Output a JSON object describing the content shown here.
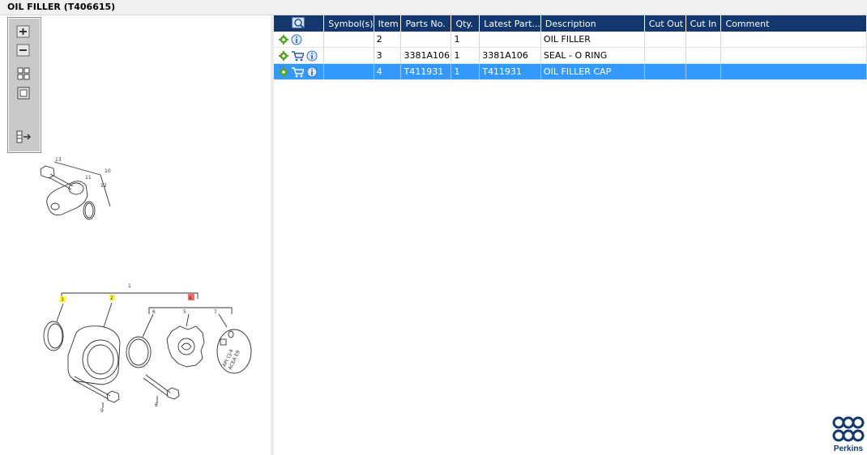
{
  "window": {
    "title": "OIL FILLER (T406615)"
  },
  "toolbar": {
    "buttons": [
      {
        "name": "zoom-in-button",
        "icon": "zoom-in-icon"
      },
      {
        "name": "zoom-out-button",
        "icon": "zoom-out-icon"
      },
      {
        "name": "fit-all-button",
        "icon": "fit-all-icon"
      },
      {
        "name": "fit-window-button",
        "icon": "fit-window-icon"
      },
      {
        "name": "layout-toggle-button",
        "icon": "layout-toggle-icon"
      }
    ]
  },
  "diagram": {
    "callouts": [
      "13",
      "10",
      "11",
      "12",
      "1",
      "3",
      "2",
      "4",
      "6",
      "5",
      "7",
      "9",
      "8"
    ],
    "label_text": [
      "API CJ-4",
      "ACEA E9"
    ],
    "highlight_colors": {
      "yellow": "#ffff33",
      "red": "#ff6666"
    }
  },
  "grid": {
    "header_icon": "search-icon",
    "columns": [
      "Symbol(s)",
      "Item",
      "Parts No.",
      "Qty.",
      "Latest Part...",
      "Description",
      "Cut Out",
      "Cut In",
      "Comment"
    ],
    "rows": [
      {
        "icons": [
          "gear-icon",
          "info-icon"
        ],
        "symbol": "",
        "item": "2",
        "parts_no": "",
        "qty": "1",
        "latest": "",
        "description": "OIL FILLER",
        "cut_out": "",
        "cut_in": "",
        "comment": ""
      },
      {
        "icons": [
          "gear-icon",
          "cart-icon",
          "info-icon"
        ],
        "symbol": "",
        "item": "3",
        "parts_no": "3381A106",
        "qty": "1",
        "latest": "3381A106",
        "description": "SEAL - O RING",
        "cut_out": "",
        "cut_in": "",
        "comment": ""
      },
      {
        "icons": [
          "gear-icon",
          "cart-icon",
          "info-icon"
        ],
        "symbol": "",
        "item": "4",
        "parts_no": "T411931",
        "qty": "1",
        "latest": "T411931",
        "description": "OIL FILLER CAP",
        "cut_out": "",
        "cut_in": "",
        "comment": "",
        "selected": true
      }
    ]
  },
  "colors": {
    "header_bg": "#14386e",
    "selected_row": "#3399ff",
    "brand": "#14386e"
  },
  "logo": {
    "text": "Perkins"
  }
}
